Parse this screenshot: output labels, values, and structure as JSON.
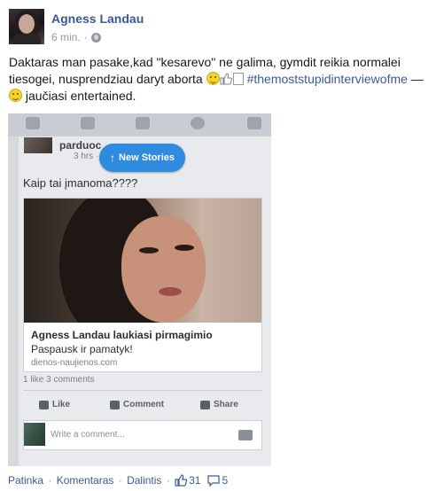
{
  "post": {
    "author": "Agness Landau",
    "time": "6 min.",
    "text_main": "Daktaras man pasake,kad \"kesarevo\" ne galima, gymdit reikia normalei tiesogei, nusprendziau daryt aborta ",
    "hashtag": "#themoststupidinterviewofme",
    "dash": " — ",
    "feeling": "jaučiasi entertained."
  },
  "screenshot": {
    "poster_name": "parduoc",
    "poster_time": "3 hrs · au",
    "new_stories": "New Stories",
    "question": "Kaip tai įmanoma????",
    "link_title": "Agness Landau laukiasi pirmagimio",
    "link_desc": "Paspausk ir pamatyk!",
    "link_domain": "dienos-naujienos.com",
    "stats": "1 like   3 comments",
    "actions": {
      "like": "Like",
      "comment": "Comment",
      "share": "Share"
    },
    "comment_placeholder": "Write a comment..."
  },
  "footer": {
    "like": "Patinka",
    "comment": "Komentaras",
    "share": "Dalintis",
    "likes_count": "31",
    "comments_count": "5"
  },
  "colors": {
    "link": "#3b5998",
    "meta": "#9197a3",
    "text": "#141823",
    "new_stories": "#2f8be0"
  },
  "icons": [
    "globe-icon",
    "grin-emoji-icon",
    "thumbs-up-icon",
    "smile-emoji-icon",
    "like-icon",
    "comment-icon",
    "share-icon",
    "camera-icon"
  ]
}
